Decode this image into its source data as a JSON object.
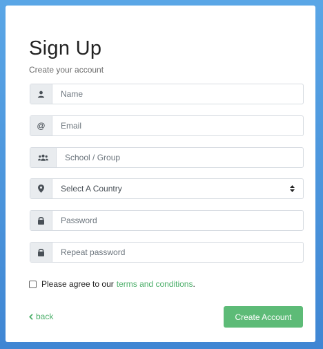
{
  "form": {
    "title": "Sign Up",
    "subtitle": "Create your account",
    "fields": {
      "name": {
        "placeholder": "Name",
        "icon": "user-icon"
      },
      "email": {
        "placeholder": "Email",
        "icon": "at-icon"
      },
      "group": {
        "placeholder": "School / Group",
        "icon": "users-icon"
      },
      "country": {
        "selected": "Select A Country",
        "icon": "map-marker-icon"
      },
      "password": {
        "placeholder": "Password",
        "icon": "lock-icon"
      },
      "repeat_password": {
        "placeholder": "Repeat password",
        "icon": "lock-icon"
      }
    },
    "agree": {
      "text": "Please agree to our",
      "link": "terms and conditions",
      "suffix": "."
    },
    "back_label": "back",
    "submit_label": "Create Account"
  },
  "colors": {
    "accent": "#5dbb77",
    "link": "#4caf6a",
    "background": "#4a95dd"
  }
}
